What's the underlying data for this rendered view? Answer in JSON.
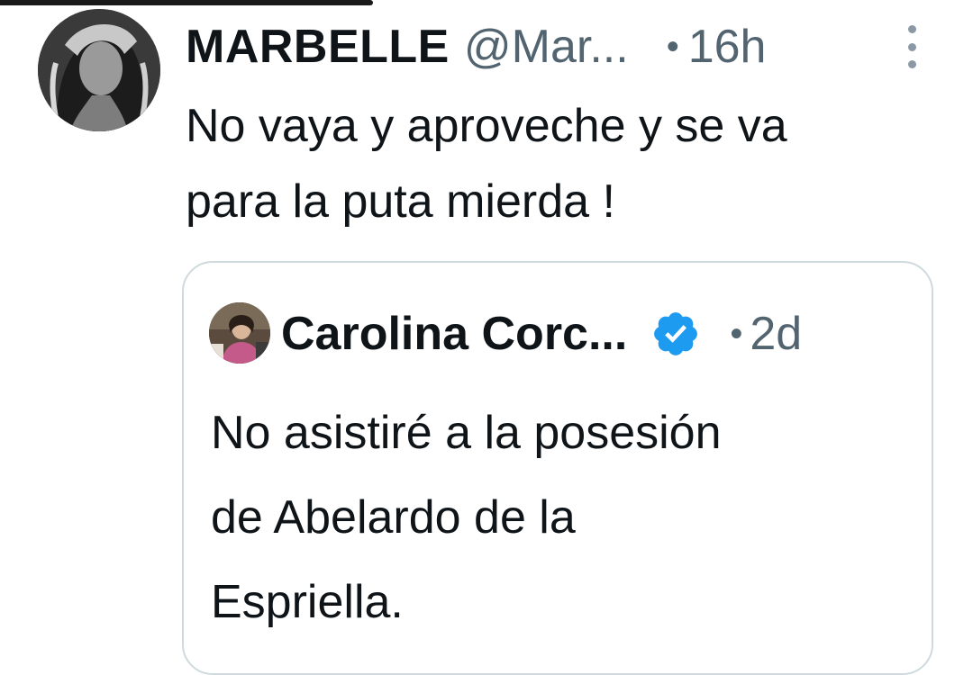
{
  "tweet": {
    "display_name": "MARBELLE",
    "handle": "@Mar...",
    "separator": "•",
    "time": "16h",
    "text_line1": "No vaya y aproveche y se va",
    "text_line2": "para la puta mierda !"
  },
  "quoted_tweet": {
    "display_name": "Carolina Corc...",
    "separator": "•",
    "time": "2d",
    "text_line1": "No asistiré a la posesión",
    "text_line2": "de Abelardo de la",
    "text_line3": "Espriella."
  },
  "icons": {
    "more": "more-vertical-icon",
    "verified": "verified-badge-icon"
  },
  "colors": {
    "text_primary": "#0f1419",
    "text_secondary": "#536471",
    "border": "#cfd9de",
    "verified_blue": "#1d9bf0"
  }
}
